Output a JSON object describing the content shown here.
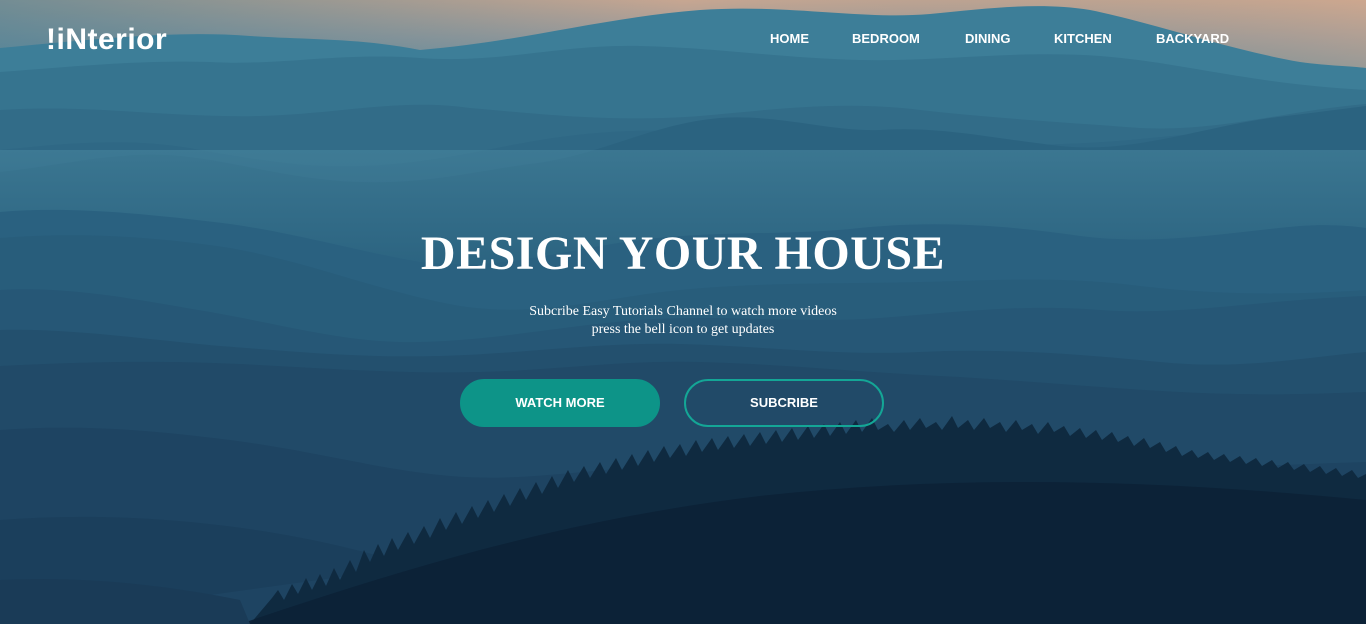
{
  "brand": {
    "logo_text": "!iNterior"
  },
  "nav": {
    "items": [
      {
        "label": "HOME"
      },
      {
        "label": "BEDROOM"
      },
      {
        "label": "DINING"
      },
      {
        "label": "KITCHEN"
      },
      {
        "label": "BACKYARD"
      }
    ]
  },
  "hero": {
    "headline": "DESIGN YOUR HOUSE",
    "subtext_line1": "Subcribe Easy Tutorials Channel to watch more videos",
    "subtext_line2": "press the bell icon to get updates",
    "primary_button_label": "WATCH MORE",
    "secondary_button_label": "SUBCRIBE"
  },
  "colors": {
    "primary_button": "#0d9488",
    "secondary_button_border": "#14a696",
    "text": "#ffffff",
    "sky_top": "#c9a48c",
    "mountain_mid": "#2a6a86",
    "forest_dark": "#0c2136"
  }
}
